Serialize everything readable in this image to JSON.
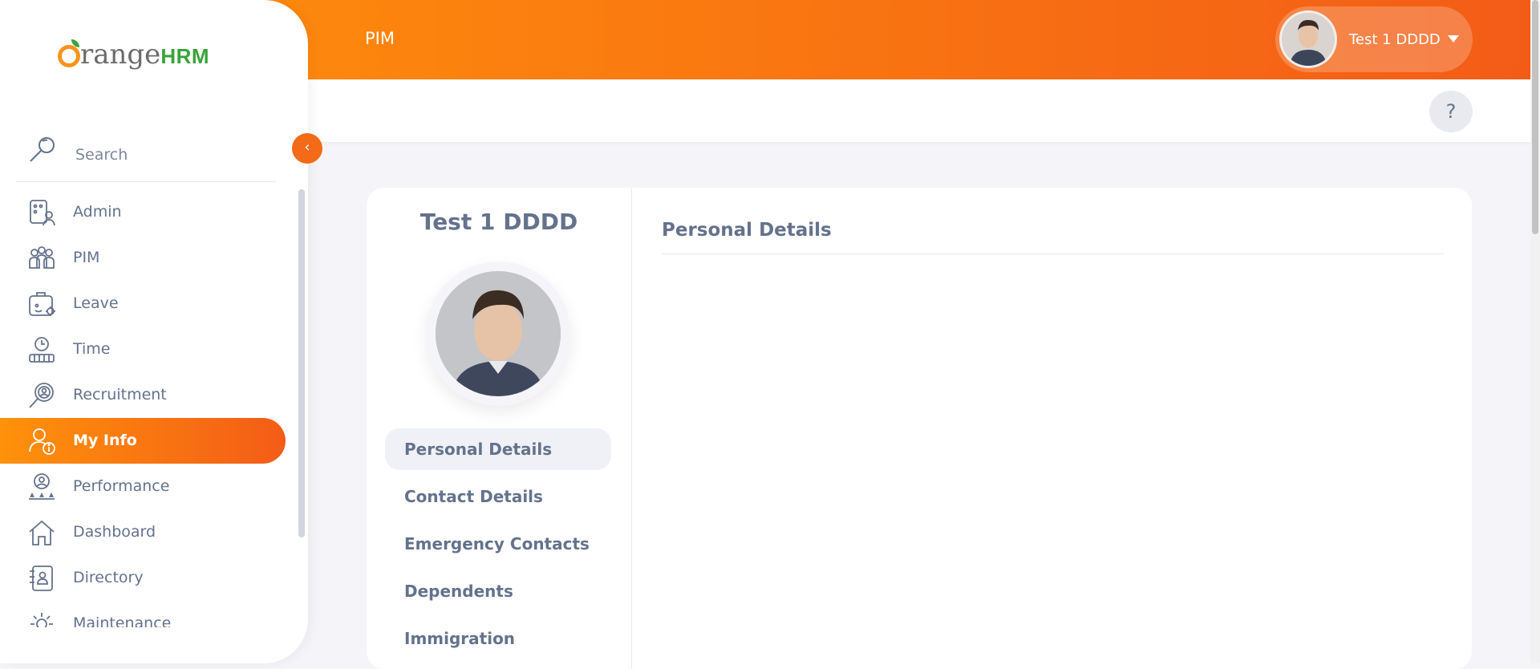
{
  "topbar": {
    "module_title": "PIM",
    "user_name": "Test 1 DDDD",
    "gradient_start": "#ff920b",
    "gradient_end": "#f35c17"
  },
  "help": {
    "label": "?"
  },
  "sidebar": {
    "brand_part1": "range",
    "brand_part2": "HRM",
    "search_placeholder": "Search",
    "collapse_icon": "‹",
    "items": [
      {
        "label": "Admin",
        "icon": "admin-icon"
      },
      {
        "label": "PIM",
        "icon": "pim-icon"
      },
      {
        "label": "Leave",
        "icon": "leave-icon"
      },
      {
        "label": "Time",
        "icon": "time-icon"
      },
      {
        "label": "Recruitment",
        "icon": "recruitment-icon"
      },
      {
        "label": "My Info",
        "icon": "my-info-icon",
        "active": true
      },
      {
        "label": "Performance",
        "icon": "performance-icon"
      },
      {
        "label": "Dashboard",
        "icon": "dashboard-icon"
      },
      {
        "label": "Directory",
        "icon": "directory-icon"
      },
      {
        "label": "Maintenance",
        "icon": "maintenance-icon"
      }
    ]
  },
  "profile": {
    "name": "Test 1 DDDD",
    "tabs": [
      {
        "label": "Personal Details",
        "active": true
      },
      {
        "label": "Contact Details"
      },
      {
        "label": "Emergency Contacts"
      },
      {
        "label": "Dependents"
      },
      {
        "label": "Immigration"
      }
    ]
  },
  "main": {
    "section_title": "Personal Details"
  }
}
